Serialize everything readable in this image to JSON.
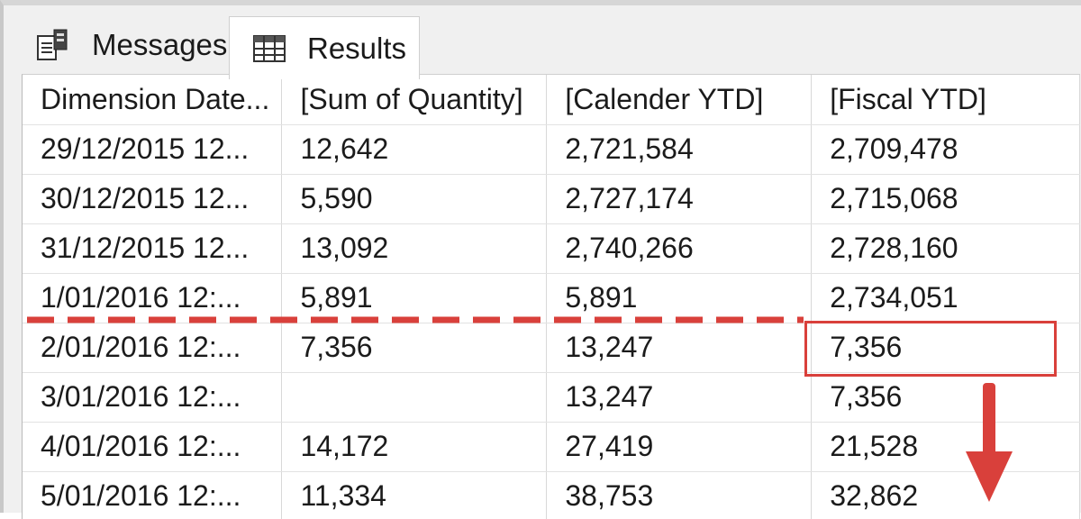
{
  "tabs": [
    {
      "label": "Messages",
      "icon": "messages-icon",
      "active": false
    },
    {
      "label": "Results",
      "icon": "grid-icon",
      "active": true
    }
  ],
  "grid": {
    "columns": [
      "Dimension Date...",
      "[Sum of Quantity]",
      "[Calender YTD]",
      "[Fiscal YTD]"
    ],
    "rows": [
      [
        "29/12/2015 12...",
        "12,642",
        "2,721,584",
        "2,709,478"
      ],
      [
        "30/12/2015 12...",
        "5,590",
        "2,727,174",
        "2,715,068"
      ],
      [
        "31/12/2015 12...",
        "13,092",
        "2,740,266",
        "2,728,160"
      ],
      [
        "1/01/2016 12:...",
        "5,891",
        "5,891",
        "2,734,051"
      ],
      [
        "2/01/2016 12:...",
        "7,356",
        "13,247",
        "7,356"
      ],
      [
        "3/01/2016 12:...",
        "",
        "13,247",
        "7,356"
      ],
      [
        "4/01/2016 12:...",
        "14,172",
        "27,419",
        "21,528"
      ],
      [
        "5/01/2016 12:...",
        "11,334",
        "38,753",
        "32,862"
      ]
    ]
  },
  "annotations": {
    "color": "#d9403b",
    "dashed_line": "fiscal year boundary between 1/01/2016 and 2/01/2016 rows",
    "highlight": "Fiscal YTD value 7,356 on 2/01/2016",
    "arrow": "down-arrow"
  }
}
